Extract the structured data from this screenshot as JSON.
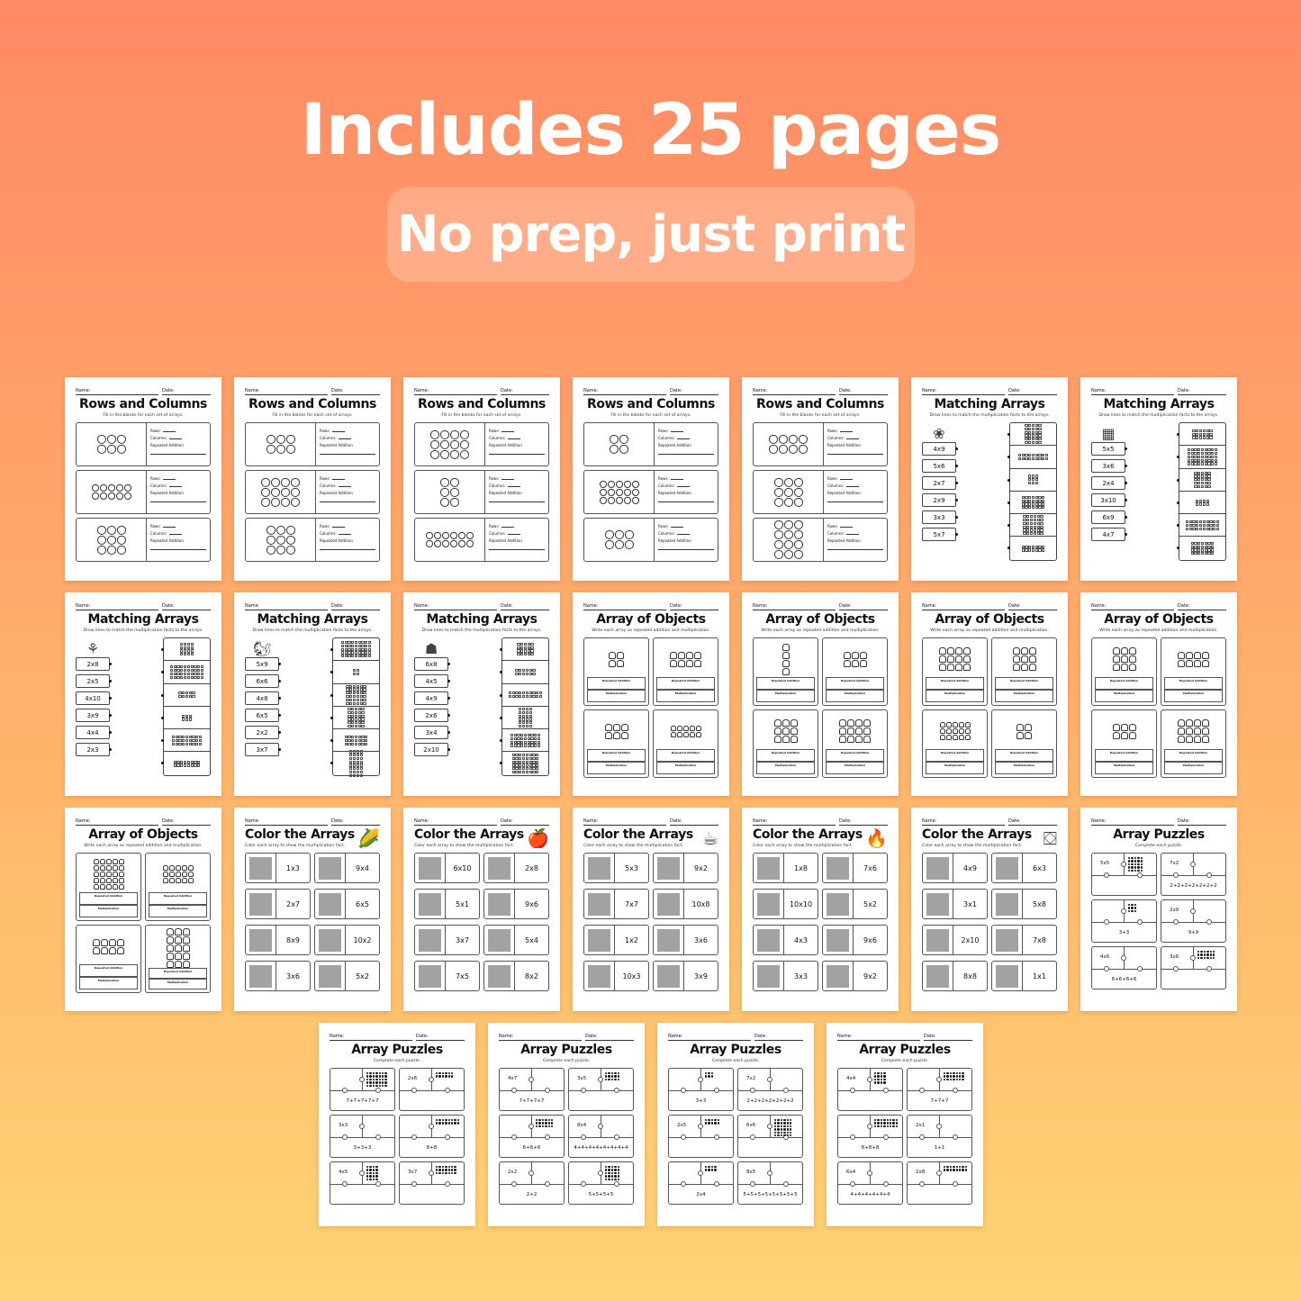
{
  "header": {
    "headline": "Includes 25 pages",
    "subheadline": "No prep, just print"
  },
  "colors": {
    "bg_top": "#ff8a63",
    "bg_bottom": "#ffd474",
    "headline": "#ffffff"
  },
  "common": {
    "name_label": "Name:",
    "date_label": "Date:",
    "rows_label": "Rows:",
    "columns_label": "Columns:",
    "repeated_addition_label": "Repeated Addition",
    "multiplication_label": "Multiplication"
  },
  "pages": [
    {
      "type": "rows-columns",
      "title": "Rows and Columns",
      "subtitle": "Fill in the blanks for each set of arrays.",
      "object": "acorn",
      "arrays": [
        [
          2,
          3
        ],
        [
          2,
          5
        ],
        [
          3,
          3
        ]
      ]
    },
    {
      "type": "rows-columns",
      "title": "Rows and Columns",
      "subtitle": "Fill in the blanks for each set of arrays.",
      "object": "pie-slice",
      "arrays": [
        [
          2,
          3
        ],
        [
          3,
          4
        ],
        [
          3,
          3
        ]
      ]
    },
    {
      "type": "rows-columns",
      "title": "Rows and Columns",
      "subtitle": "Fill in the blanks for each set of arrays.",
      "object": "witch-hat",
      "arrays": [
        [
          3,
          4
        ],
        [
          3,
          2
        ],
        [
          2,
          6
        ]
      ]
    },
    {
      "type": "rows-columns",
      "title": "Rows and Columns",
      "subtitle": "Fill in the blanks for each set of arrays.",
      "object": "maple-leaf",
      "arrays": [
        [
          2,
          2
        ],
        [
          3,
          5
        ],
        [
          2,
          3
        ]
      ]
    },
    {
      "type": "rows-columns",
      "title": "Rows and Columns",
      "subtitle": "Fill in the blanks for each set of arrays.",
      "object": "pumpkin",
      "arrays": [
        [
          2,
          4
        ],
        [
          3,
          3
        ],
        [
          4,
          3
        ]
      ]
    },
    {
      "type": "matching",
      "title": "Matching Arrays",
      "subtitle": "Draw lines to match the multiplication facts to the arrays.",
      "decoration": "plant",
      "facts": [
        "4x9",
        "5x6",
        "2x7",
        "2x9",
        "3x3",
        "5x7"
      ],
      "arrays": [
        [
          6,
          5
        ],
        [
          2,
          9
        ],
        [
          3,
          3
        ],
        [
          4,
          7
        ],
        [
          6,
          6
        ],
        [
          2,
          7
        ]
      ]
    },
    {
      "type": "matching",
      "title": "Matching Arrays",
      "subtitle": "Draw lines to match the multiplication facts to the arrays.",
      "decoration": "boxes",
      "facts": [
        "5x5",
        "3x6",
        "2x4",
        "3x10",
        "6x9",
        "4x7"
      ],
      "arrays": [
        [
          3,
          6
        ],
        [
          5,
          9
        ],
        [
          5,
          5
        ],
        [
          2,
          4
        ],
        [
          3,
          10
        ],
        [
          4,
          7
        ]
      ]
    },
    {
      "type": "matching",
      "title": "Matching Arrays",
      "subtitle": "Draw lines to match the multiplication facts to the arrays.",
      "decoration": "wheat",
      "facts": [
        "2x8",
        "2x5",
        "4x10",
        "3x9",
        "4x4",
        "2x3"
      ],
      "arrays": [
        [
          4,
          4
        ],
        [
          4,
          10
        ],
        [
          2,
          5
        ],
        [
          2,
          3
        ],
        [
          3,
          9
        ],
        [
          2,
          8
        ]
      ]
    },
    {
      "type": "matching",
      "title": "Matching Arrays",
      "subtitle": "Draw lines to match the multiplication facts to the arrays.",
      "decoration": "squirrel",
      "facts": [
        "5x9",
        "6x6",
        "4x8",
        "6x5",
        "2x2",
        "3x7"
      ],
      "arrays": [
        [
          5,
          9
        ],
        [
          2,
          2
        ],
        [
          6,
          6
        ],
        [
          6,
          5
        ],
        [
          3,
          7
        ],
        [
          8,
          4
        ]
      ]
    },
    {
      "type": "matching",
      "title": "Matching Arrays",
      "subtitle": "Draw lines to match the multiplication facts to the arrays.",
      "decoration": "scarecrow",
      "facts": [
        "6x8",
        "4x5",
        "4x9",
        "2x6",
        "3x4",
        "2x10"
      ],
      "arrays": [
        [
          4,
          5
        ],
        [
          2,
          6
        ],
        [
          2,
          10
        ],
        [
          6,
          4
        ],
        [
          4,
          9
        ],
        [
          6,
          8
        ]
      ]
    },
    {
      "type": "objects",
      "title": "Array of Objects",
      "subtitle": "Write each array as repeated addition and multiplication.",
      "object": "jacket",
      "arrays": [
        [
          2,
          2
        ],
        [
          2,
          4
        ],
        [
          2,
          3
        ],
        [
          2,
          5
        ]
      ]
    },
    {
      "type": "objects",
      "title": "Array of Objects",
      "subtitle": "Write each array as repeated addition and multiplication.",
      "object": "mushroom",
      "arrays": [
        [
          4,
          1
        ],
        [
          2,
          3
        ],
        [
          3,
          3
        ],
        [
          3,
          4
        ]
      ]
    },
    {
      "type": "objects",
      "title": "Array of Objects",
      "subtitle": "Write each array as repeated addition and multiplication.",
      "object": "leaf",
      "arrays": [
        [
          3,
          4
        ],
        [
          3,
          3
        ],
        [
          3,
          5
        ],
        [
          2,
          2
        ]
      ]
    },
    {
      "type": "objects",
      "title": "Array of Objects",
      "subtitle": "Write each array as repeated addition and multiplication.",
      "object": "pie",
      "arrays": [
        [
          3,
          3
        ],
        [
          2,
          4
        ],
        [
          2,
          3
        ],
        [
          3,
          4
        ]
      ]
    },
    {
      "type": "objects",
      "title": "Array of Objects",
      "subtitle": "Write each array as repeated addition and multiplication.",
      "object": "football",
      "arrays": [
        [
          5,
          5
        ],
        [
          3,
          5
        ],
        [
          2,
          4
        ],
        [
          5,
          3
        ]
      ]
    },
    {
      "type": "color",
      "title": "Color the Arrays",
      "subtitle": "Color each array to show the multiplication fact.",
      "decoration": "corn",
      "facts": [
        "1x3",
        "9x4",
        "2x7",
        "6x5",
        "8x9",
        "10x2",
        "3x6",
        "5x2"
      ]
    },
    {
      "type": "color",
      "title": "Color the Arrays",
      "subtitle": "Color each array to show the multiplication fact.",
      "decoration": "candy-apple",
      "facts": [
        "6x10",
        "2x8",
        "5x1",
        "9x6",
        "3x7",
        "5x4",
        "7x5",
        "8x2"
      ]
    },
    {
      "type": "color",
      "title": "Color the Arrays",
      "subtitle": "Color each array to show the multiplication fact.",
      "decoration": "tea-cup",
      "facts": [
        "5x3",
        "9x2",
        "7x7",
        "10x8",
        "1x2",
        "3x6",
        "10x3",
        "3x9"
      ]
    },
    {
      "type": "color",
      "title": "Color the Arrays",
      "subtitle": "Color each array to show the multiplication fact.",
      "decoration": "campfire",
      "facts": [
        "1x8",
        "7x6",
        "10x10",
        "5x2",
        "4x3",
        "9x6",
        "3x3",
        "9x2"
      ]
    },
    {
      "type": "color",
      "title": "Color the Arrays",
      "subtitle": "Color each array to show the multiplication fact.",
      "decoration": "pumpkin-sign",
      "facts": [
        "4x9",
        "6x3",
        "3x1",
        "5x8",
        "2x10",
        "7x8",
        "8x8",
        "1x1"
      ]
    },
    {
      "type": "puzzle",
      "title": "Array Puzzles",
      "subtitle": "Complete each puzzle.",
      "puzzles": [
        {
          "fact": "5x5",
          "dots": [
            5,
            5
          ],
          "addition": ""
        },
        {
          "fact": "7x2",
          "dots": null,
          "addition": "2+2+2+2+2+2+2"
        },
        {
          "fact": "",
          "dots": [
            3,
            3
          ],
          "addition": "3+3"
        },
        {
          "fact": "2x9",
          "dots": null,
          "addition": "9+9"
        },
        {
          "fact": "4x6",
          "dots": null,
          "addition": "6+6+6+6"
        },
        {
          "fact": "3x6",
          "dots": [
            3,
            6
          ],
          "addition": ""
        }
      ]
    },
    {
      "type": "puzzle",
      "title": "Array Puzzles",
      "subtitle": "Complete each puzzle.",
      "puzzles": [
        {
          "fact": "",
          "dots": [
            5,
            7
          ],
          "addition": "7+7+7+7+7"
        },
        {
          "fact": "2x6",
          "dots": [
            2,
            6
          ],
          "addition": ""
        },
        {
          "fact": "3x3",
          "dots": null,
          "addition": "3+3+3"
        },
        {
          "fact": "",
          "dots": [
            2,
            8
          ],
          "addition": "8+8"
        },
        {
          "fact": "4x5",
          "dots": [
            5,
            4
          ],
          "addition": ""
        },
        {
          "fact": "3x7",
          "dots": [
            3,
            7
          ],
          "addition": ""
        }
      ]
    },
    {
      "type": "puzzle",
      "title": "Array Puzzles",
      "subtitle": "Complete each puzzle.",
      "puzzles": [
        {
          "fact": "4x7",
          "dots": null,
          "addition": "7+7+7+7"
        },
        {
          "fact": "3x5",
          "dots": [
            3,
            5
          ],
          "addition": ""
        },
        {
          "fact": "",
          "dots": [
            3,
            6
          ],
          "addition": "6+6+6"
        },
        {
          "fact": "8x4",
          "dots": null,
          "addition": "4+4+4+4+4+4+4+4"
        },
        {
          "fact": "2x2",
          "dots": null,
          "addition": "2+2"
        },
        {
          "fact": "",
          "dots": [
            5,
            5
          ],
          "addition": "5+5+5+5"
        }
      ]
    },
    {
      "type": "puzzle",
      "title": "Array Puzzles",
      "subtitle": "Complete each puzzle.",
      "puzzles": [
        {
          "fact": "",
          "dots": [
            2,
            3
          ],
          "addition": "3+3"
        },
        {
          "fact": "7x2",
          "dots": null,
          "addition": "2+2+2+2+2+2+2"
        },
        {
          "fact": "2x5",
          "dots": [
            2,
            5
          ],
          "addition": ""
        },
        {
          "fact": "6x6",
          "dots": [
            6,
            6
          ],
          "addition": ""
        },
        {
          "fact": "",
          "dots": [
            2,
            4
          ],
          "addition": "2x4"
        },
        {
          "fact": "8x5",
          "dots": null,
          "addition": "5+5+5+5+5+5+5+5"
        }
      ]
    },
    {
      "type": "puzzle",
      "title": "Array Puzzles",
      "subtitle": "Complete each puzzle.",
      "puzzles": [
        {
          "fact": "4x4",
          "dots": [
            4,
            4
          ],
          "addition": ""
        },
        {
          "fact": "",
          "dots": [
            3,
            7
          ],
          "addition": "7+7+7"
        },
        {
          "fact": "",
          "dots": [
            3,
            8
          ],
          "addition": "8+8+8"
        },
        {
          "fact": "2x1",
          "dots": null,
          "addition": "1+1"
        },
        {
          "fact": "6x4",
          "dots": null,
          "addition": "4+4+4+4+4+4"
        },
        {
          "fact": "2x8",
          "dots": [
            2,
            8
          ],
          "addition": ""
        }
      ]
    }
  ]
}
